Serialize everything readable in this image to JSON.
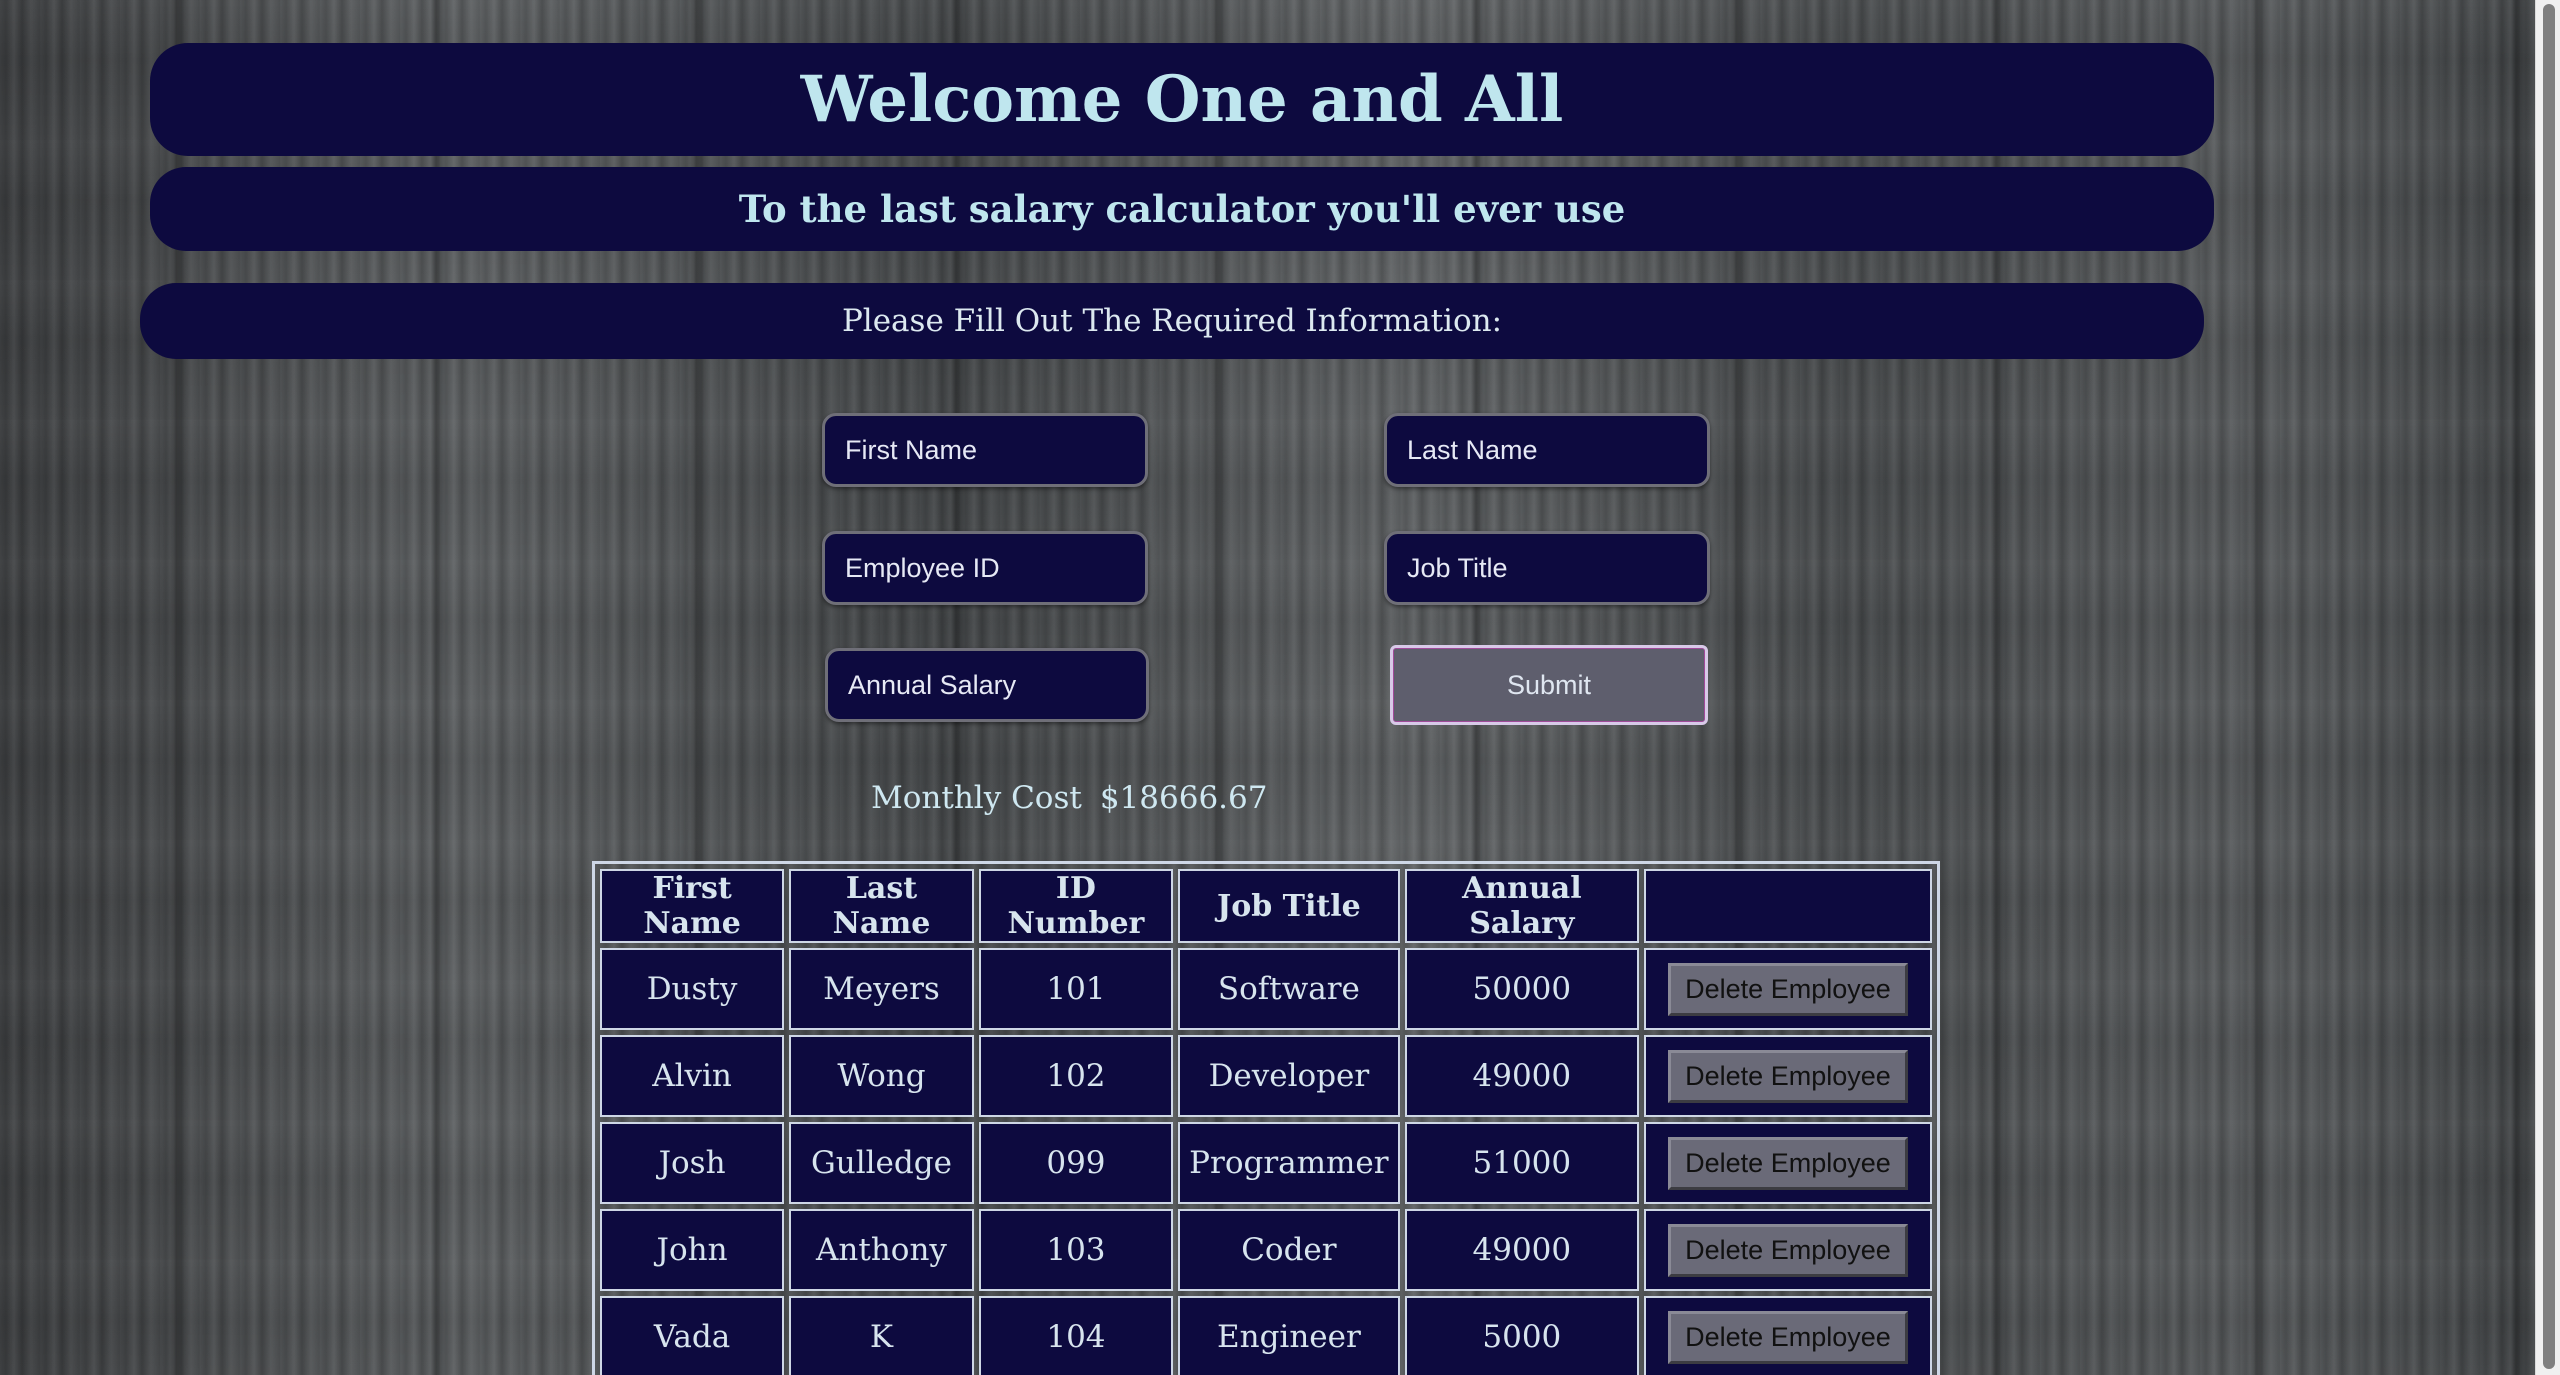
{
  "header": {
    "title": "Welcome One and All",
    "subtitle": "To the last salary calculator you'll ever use",
    "instruction": "Please Fill Out The Required Information:"
  },
  "form": {
    "first_name_placeholder": "First Name",
    "last_name_placeholder": "Last Name",
    "employee_id_placeholder": "Employee ID",
    "job_title_placeholder": "Job Title",
    "annual_salary_placeholder": "Annual Salary",
    "submit_label": "Submit"
  },
  "summary": {
    "monthly_label": "Monthly Cost",
    "monthly_value": "$18666.67"
  },
  "table": {
    "headers": [
      "First Name",
      "Last Name",
      "ID Number",
      "Job Title",
      "Annual Salary",
      ""
    ],
    "delete_label": "Delete Employee",
    "rows": [
      {
        "first": "Dusty",
        "last": "Meyers",
        "id": "101",
        "title": "Software",
        "salary": "50000"
      },
      {
        "first": "Alvin",
        "last": "Wong",
        "id": "102",
        "title": "Developer",
        "salary": "49000"
      },
      {
        "first": "Josh",
        "last": "Gulledge",
        "id": "099",
        "title": "Programmer",
        "salary": "51000"
      },
      {
        "first": "John",
        "last": "Anthony",
        "id": "103",
        "title": "Coder",
        "salary": "49000"
      },
      {
        "first": "Vada",
        "last": "K",
        "id": "104",
        "title": "Engineer",
        "salary": "5000"
      }
    ]
  },
  "colors": {
    "panel": "#0d0a3f",
    "text_accent": "#bfe6ee",
    "submit_border": "#d8c9e8"
  }
}
